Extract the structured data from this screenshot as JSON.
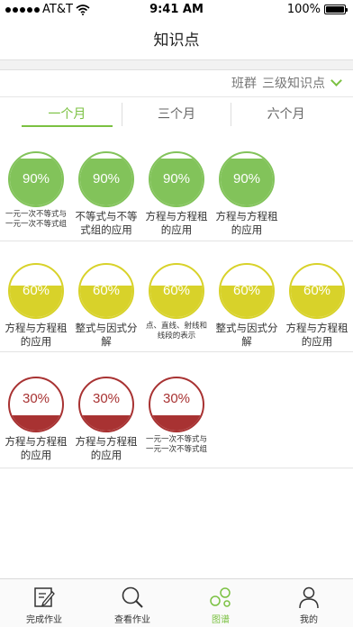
{
  "status": {
    "carrier": "AT&T",
    "time": "9:41 AM",
    "battery": "100%"
  },
  "nav": {
    "title": "知识点"
  },
  "filter": {
    "class": "班群",
    "level": "三级知识点"
  },
  "tabs": [
    "一个月",
    "三个月",
    "六个月"
  ],
  "active_tab": 0,
  "colors": {
    "green": "#82c35a",
    "yellow": "#d8d22a",
    "red": "#a83232",
    "accent": "#7bc142"
  },
  "sections": [
    {
      "color": "green",
      "items": [
        {
          "percent": "90%",
          "level": 0.9,
          "label": "一元一次不等式与一元一次不等式组",
          "small": true
        },
        {
          "percent": "90%",
          "level": 0.9,
          "label": "不等式与不等式组的应用",
          "small": false
        },
        {
          "percent": "90%",
          "level": 0.9,
          "label": "方程与方程租的应用",
          "small": false
        },
        {
          "percent": "90%",
          "level": 0.9,
          "label": "方程与方程租的应用",
          "small": false
        }
      ]
    },
    {
      "color": "yellow",
      "items": [
        {
          "percent": "60%",
          "level": 0.6,
          "label": "方程与方程租的应用",
          "small": false
        },
        {
          "percent": "60%",
          "level": 0.6,
          "label": "整式与因式分解",
          "small": false
        },
        {
          "percent": "60%",
          "level": 0.6,
          "label": "点、直线、射线和线段的表示",
          "small": true
        },
        {
          "percent": "60%",
          "level": 0.6,
          "label": "整式与因式分解",
          "small": false
        },
        {
          "percent": "60%",
          "level": 0.6,
          "label": "方程与方程租的应用",
          "small": false
        }
      ]
    },
    {
      "color": "red",
      "items": [
        {
          "percent": "30%",
          "level": 0.3,
          "label": "方程与方程租的应用",
          "small": false
        },
        {
          "percent": "30%",
          "level": 0.3,
          "label": "方程与方程租的应用",
          "small": false
        },
        {
          "percent": "30%",
          "level": 0.3,
          "label": "一元一次不等式与一元一次不等式组",
          "small": true
        }
      ]
    }
  ],
  "tabbar": [
    {
      "label": "完成作业",
      "icon": "edit-icon"
    },
    {
      "label": "查看作业",
      "icon": "search-icon"
    },
    {
      "label": "图谱",
      "icon": "graph-icon"
    },
    {
      "label": "我的",
      "icon": "person-icon"
    }
  ],
  "tabbar_active": 2
}
